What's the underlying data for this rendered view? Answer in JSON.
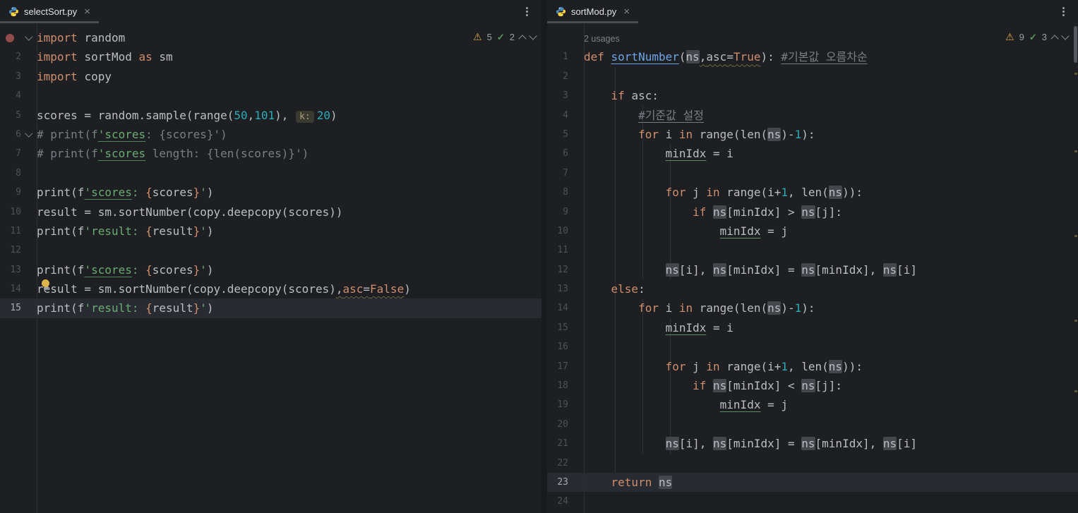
{
  "colors": {
    "background": "#1E1F22",
    "keyword": "#CF8E6D",
    "string": "#6AAB73",
    "number": "#2AACB8",
    "comment": "#7A7E85",
    "warning": "#D9A74A",
    "ok": "#57965C",
    "current_line": "#282B31",
    "occurrence_highlight": "#44474C"
  },
  "icons": {
    "close": "×",
    "warning": "⚠",
    "check": "✓"
  },
  "left_pane": {
    "tab_title": "selectSort.py",
    "inspections": {
      "warnings": "5",
      "typos": "2"
    },
    "lines": [
      {
        "n": "1",
        "bp": true,
        "fold": true,
        "t": [
          [
            "import ",
            "k"
          ],
          [
            "random",
            "p"
          ]
        ]
      },
      {
        "n": "2",
        "t": [
          [
            "import ",
            "k"
          ],
          [
            "sortMod ",
            "p"
          ],
          [
            "as",
            "k"
          ],
          [
            " sm",
            "p"
          ]
        ]
      },
      {
        "n": "3",
        "t": [
          [
            "import ",
            "k"
          ],
          [
            "copy",
            "p"
          ]
        ]
      },
      {
        "n": "4",
        "t": []
      },
      {
        "n": "5",
        "t": [
          [
            "scores = random.sample(range(",
            "p"
          ],
          [
            "50",
            "n"
          ],
          [
            ",",
            "p"
          ],
          [
            "101",
            "n"
          ],
          [
            "), ",
            "p"
          ],
          [
            "k:",
            "hint"
          ],
          [
            "20",
            "n"
          ],
          [
            ")",
            "p"
          ]
        ]
      },
      {
        "n": "6",
        "fold": true,
        "t": [
          [
            "# print(f",
            "c"
          ],
          [
            "'scores",
            "su"
          ],
          [
            ": {scores}')",
            "c"
          ]
        ]
      },
      {
        "n": "7",
        "t": [
          [
            "# print(f",
            "c"
          ],
          [
            "'scores",
            "su"
          ],
          [
            " length: {len(scores)}')",
            "c"
          ]
        ]
      },
      {
        "n": "8",
        "t": []
      },
      {
        "n": "9",
        "t": [
          [
            "print(f",
            "p"
          ],
          [
            "'scores",
            "su"
          ],
          [
            ": ",
            "s"
          ],
          [
            "{",
            "k"
          ],
          [
            "scores",
            "p"
          ],
          [
            "}",
            "k"
          ],
          [
            "'",
            "s"
          ],
          [
            ")",
            "p"
          ]
        ]
      },
      {
        "n": "10",
        "t": [
          [
            "result = sm.sortNumber(copy.deepcopy(scores))",
            "p"
          ]
        ]
      },
      {
        "n": "11",
        "t": [
          [
            "print(f",
            "p"
          ],
          [
            "'result: ",
            "s"
          ],
          [
            "{",
            "k"
          ],
          [
            "result",
            "p"
          ],
          [
            "}",
            "k"
          ],
          [
            "'",
            "s"
          ],
          [
            ")",
            "p"
          ]
        ]
      },
      {
        "n": "12",
        "t": []
      },
      {
        "n": "13",
        "t": [
          [
            "print(f",
            "p"
          ],
          [
            "'scores",
            "su"
          ],
          [
            ": ",
            "s"
          ],
          [
            "{",
            "k"
          ],
          [
            "scores",
            "p"
          ],
          [
            "}",
            "k"
          ],
          [
            "'",
            "s"
          ],
          [
            ")",
            "p"
          ]
        ]
      },
      {
        "n": "14",
        "t": [
          [
            "result = sm.sortNumber(copy.deepcopy(scores)",
            "p"
          ],
          [
            ",",
            "p wavy"
          ],
          [
            "asc",
            "kwarg wavy"
          ],
          [
            "=",
            "p wavy"
          ],
          [
            "False",
            "k wavy"
          ],
          [
            ")",
            "p"
          ]
        ]
      },
      {
        "n": "15",
        "cur": true,
        "t": [
          [
            "print(f",
            "p"
          ],
          [
            "'result: ",
            "s"
          ],
          [
            "{",
            "k"
          ],
          [
            "result",
            "p"
          ],
          [
            "}",
            "k"
          ],
          [
            "'",
            "s"
          ],
          [
            ")",
            "p"
          ]
        ]
      }
    ]
  },
  "right_pane": {
    "tab_title": "sortMod.py",
    "inspections": {
      "warnings": "9",
      "typos": "3"
    },
    "lines": [
      {
        "n": "",
        "usages": "2 usages",
        "t": []
      },
      {
        "n": "1",
        "t": [
          [
            "def ",
            "k"
          ],
          [
            "sortNumber",
            "fn"
          ],
          [
            "(",
            "p"
          ],
          [
            "ns",
            "nsbox"
          ],
          [
            ",",
            "p wavy"
          ],
          [
            "asc",
            "p wavy"
          ],
          [
            "=",
            "p wavy"
          ],
          [
            "True",
            "k wavy"
          ],
          [
            "): ",
            "p"
          ],
          [
            "#기본값 오름차순",
            "cu"
          ]
        ]
      },
      {
        "n": "2",
        "t": []
      },
      {
        "n": "3",
        "t": [
          [
            "    ",
            "p"
          ],
          [
            "if ",
            "k"
          ],
          [
            "asc:",
            "p"
          ]
        ]
      },
      {
        "n": "4",
        "t": [
          [
            "        ",
            "p"
          ],
          [
            "#기준값 설정",
            "cu"
          ]
        ]
      },
      {
        "n": "5",
        "t": [
          [
            "        ",
            "p"
          ],
          [
            "for ",
            "k"
          ],
          [
            "i ",
            "p"
          ],
          [
            "in ",
            "k"
          ],
          [
            "range(len(",
            "p"
          ],
          [
            "ns",
            "nsbox"
          ],
          [
            ")-",
            "p"
          ],
          [
            "1",
            "n"
          ],
          [
            "):",
            "p"
          ]
        ]
      },
      {
        "n": "6",
        "t": [
          [
            "            ",
            "p"
          ],
          [
            "minIdx",
            "pu"
          ],
          [
            " = i",
            "p"
          ]
        ]
      },
      {
        "n": "7",
        "t": []
      },
      {
        "n": "8",
        "t": [
          [
            "            ",
            "p"
          ],
          [
            "for ",
            "k"
          ],
          [
            "j ",
            "p"
          ],
          [
            "in ",
            "k"
          ],
          [
            "range(i+",
            "p"
          ],
          [
            "1",
            "n"
          ],
          [
            ", len(",
            "p"
          ],
          [
            "ns",
            "nsbox"
          ],
          [
            ")):",
            "p"
          ]
        ]
      },
      {
        "n": "9",
        "t": [
          [
            "                ",
            "p"
          ],
          [
            "if ",
            "k"
          ],
          [
            "ns",
            "nsbox"
          ],
          [
            "[minIdx] > ",
            "p"
          ],
          [
            "ns",
            "nsbox"
          ],
          [
            "[j]:",
            "p"
          ]
        ]
      },
      {
        "n": "10",
        "t": [
          [
            "                    ",
            "p"
          ],
          [
            "minIdx",
            "pu"
          ],
          [
            " = j",
            "p"
          ]
        ]
      },
      {
        "n": "11",
        "t": []
      },
      {
        "n": "12",
        "t": [
          [
            "            ",
            "p"
          ],
          [
            "ns",
            "nsbox"
          ],
          [
            "[i], ",
            "p"
          ],
          [
            "ns",
            "nsbox"
          ],
          [
            "[minIdx] = ",
            "p"
          ],
          [
            "ns",
            "nsbox"
          ],
          [
            "[minIdx], ",
            "p"
          ],
          [
            "ns",
            "nsbox"
          ],
          [
            "[i]",
            "p"
          ]
        ]
      },
      {
        "n": "13",
        "t": [
          [
            "    ",
            "p"
          ],
          [
            "else",
            "k"
          ],
          [
            ":",
            "p"
          ]
        ]
      },
      {
        "n": "14",
        "t": [
          [
            "        ",
            "p"
          ],
          [
            "for ",
            "k"
          ],
          [
            "i ",
            "p"
          ],
          [
            "in ",
            "k"
          ],
          [
            "range(len(",
            "p"
          ],
          [
            "ns",
            "nsbox"
          ],
          [
            ")-",
            "p"
          ],
          [
            "1",
            "n"
          ],
          [
            "):",
            "p"
          ]
        ]
      },
      {
        "n": "15",
        "t": [
          [
            "            ",
            "p"
          ],
          [
            "minIdx",
            "pu"
          ],
          [
            " = i",
            "p"
          ]
        ]
      },
      {
        "n": "16",
        "t": []
      },
      {
        "n": "17",
        "t": [
          [
            "            ",
            "p"
          ],
          [
            "for ",
            "k"
          ],
          [
            "j ",
            "p"
          ],
          [
            "in ",
            "k"
          ],
          [
            "range(i+",
            "p"
          ],
          [
            "1",
            "n"
          ],
          [
            ", len(",
            "p"
          ],
          [
            "ns",
            "nsbox"
          ],
          [
            ")):",
            "p"
          ]
        ]
      },
      {
        "n": "18",
        "t": [
          [
            "                ",
            "p"
          ],
          [
            "if ",
            "k"
          ],
          [
            "ns",
            "nsbox"
          ],
          [
            "[minIdx] < ",
            "p"
          ],
          [
            "ns",
            "nsbox"
          ],
          [
            "[j]:",
            "p"
          ]
        ]
      },
      {
        "n": "19",
        "t": [
          [
            "                    ",
            "p"
          ],
          [
            "minIdx",
            "pu"
          ],
          [
            " = j",
            "p"
          ]
        ]
      },
      {
        "n": "20",
        "t": []
      },
      {
        "n": "21",
        "t": [
          [
            "            ",
            "p"
          ],
          [
            "ns",
            "nsbox"
          ],
          [
            "[i], ",
            "p"
          ],
          [
            "ns",
            "nsbox"
          ],
          [
            "[minIdx] = ",
            "p"
          ],
          [
            "ns",
            "nsbox"
          ],
          [
            "[minIdx], ",
            "p"
          ],
          [
            "ns",
            "nsbox"
          ],
          [
            "[i]",
            "p"
          ]
        ]
      },
      {
        "n": "22",
        "t": []
      },
      {
        "n": "23",
        "cur": true,
        "t": [
          [
            "    ",
            "p"
          ],
          [
            "return ",
            "k"
          ],
          [
            "ns",
            "nsbox"
          ]
        ]
      },
      {
        "n": "24",
        "t": []
      }
    ]
  }
}
